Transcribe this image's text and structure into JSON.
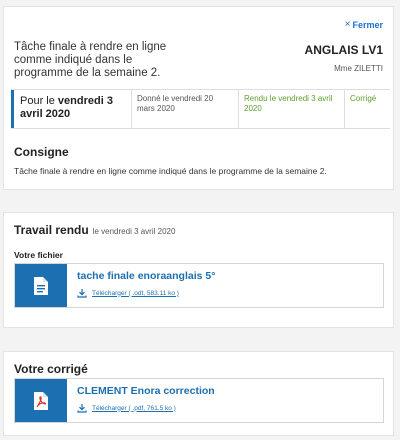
{
  "header": {
    "close_label": "Fermer",
    "task_description": "Tâche finale à rendre en ligne comme indiqué dans le programme de la semaine 2.",
    "subject": "ANGLAIS LV1",
    "teacher": "Mme ZILETTI"
  },
  "timeline": {
    "due_prefix": "Pour le ",
    "due_date": "vendredi 3 avril 2020",
    "given": "Donné le vendredi 20 mars 2020",
    "returned": "Rendu le vendredi 3 avril 2020",
    "corrected": "Corrigé"
  },
  "consigne": {
    "title": "Consigne",
    "text": "Tâche finale à rendre en ligne comme indiqué dans le programme de la semaine 2."
  },
  "travail_rendu": {
    "title": "Travail rendu",
    "date": "le vendredi 3 avril 2020",
    "file_label": "Votre fichier",
    "file": {
      "name": "tache finale enoraanglais 5°",
      "download": "Télécharger ( .odt, 583.11 ko )",
      "icon": "document-icon",
      "color": "#1c6fb0"
    }
  },
  "corrige": {
    "title": "Votre corrigé",
    "file": {
      "name": "CLEMENT Enora correction",
      "download": "Télécharger ( .pdf, 761.5 ko )",
      "icon": "pdf-icon",
      "color": "#1c6fb0"
    }
  },
  "colors": {
    "accent": "#1c6fb0",
    "link": "#1e6fd0",
    "success": "#5c9f2a"
  }
}
